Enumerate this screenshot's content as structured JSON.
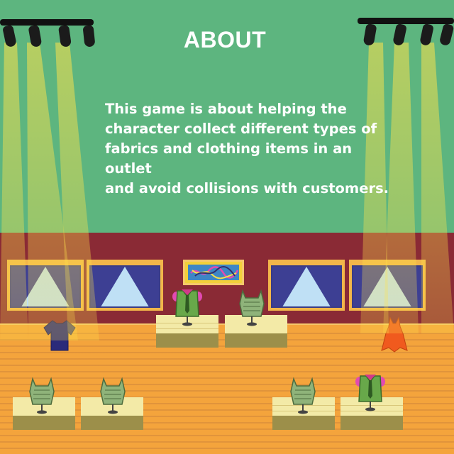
{
  "title": "ABOUT",
  "about_text": "This game is about helping the\ncharacter collect different types of\nfabrics and clothing items in an outlet\nand avoid collisions with customers.",
  "colors": {
    "background": "#5db57f",
    "wall": "#8a2a35",
    "floor": "#f4a43c",
    "text": "#ffffff",
    "spotlight": "#ffe24a"
  },
  "icons": {
    "shirt": "navy-shirt-icon",
    "dress": "orange-dress-icon",
    "top": "green-top-icon",
    "vest": "green-vest-with-tie-icon"
  }
}
